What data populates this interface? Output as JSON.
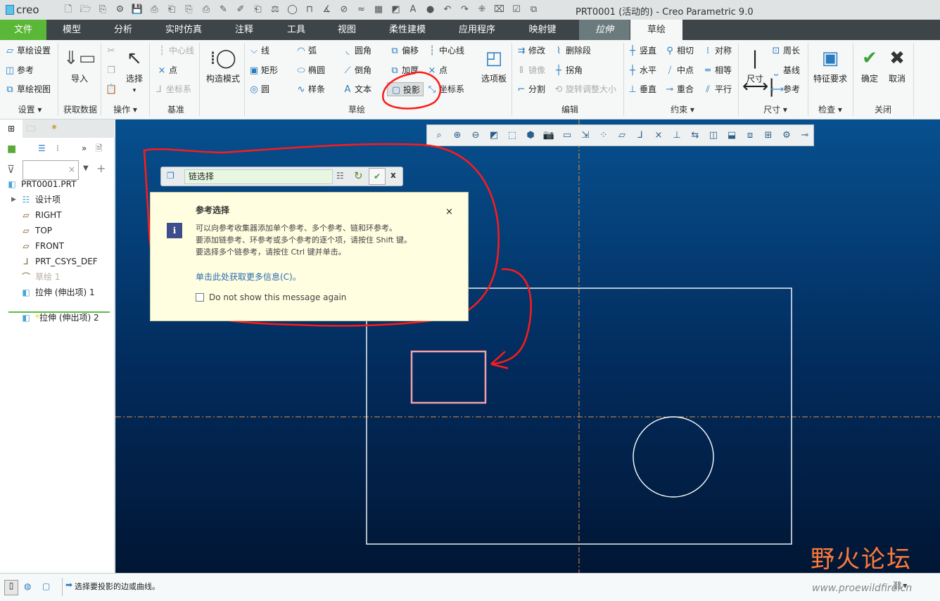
{
  "titlebar": {
    "logo": "creo",
    "title": "PRT0001 (活动的) - Creo Parametric 9.0",
    "quick_access_icons": [
      "new-icon",
      "open-icon",
      "regenerate-icon",
      "switch-window-icon",
      "save-icon",
      "save-as-icon",
      "backup-icon",
      "copy-icon",
      "print-icon",
      "close-icon",
      "cut-icon",
      "paste-icon",
      "measure-icon",
      "shading-icon",
      "dimension-icon",
      "angle-icon",
      "diameter-icon",
      "spline-icon",
      "color-icon",
      "appearance-icon",
      "text-icon",
      "sphere-icon",
      "undo-icon",
      "redo-icon",
      "settings-icon",
      "close-window-icon",
      "select-icon",
      "window-icon"
    ]
  },
  "tabs": [
    {
      "label": "文件"
    },
    {
      "label": "模型"
    },
    {
      "label": "分析"
    },
    {
      "label": "实时仿真"
    },
    {
      "label": "注释"
    },
    {
      "label": "工具"
    },
    {
      "label": "视图"
    },
    {
      "label": "柔性建模"
    },
    {
      "label": "应用程序"
    },
    {
      "label": "映射键"
    },
    {
      "label": "拉伸"
    },
    {
      "label": "草绘"
    }
  ],
  "ribbon": {
    "setup": {
      "items": [
        "草绘设置",
        "参考",
        "草绘视图"
      ],
      "label": "设置"
    },
    "get_data": {
      "import": "导入",
      "label": "获取数据"
    },
    "operations": {
      "select": "选择",
      "label": "操作"
    },
    "datum": {
      "items": [
        "中心线",
        "点",
        "坐标系"
      ],
      "label": "基准"
    },
    "construction": "构造模式",
    "sketch": {
      "col1": [
        "线",
        "矩形",
        "圆"
      ],
      "col2": [
        "弧",
        "椭圆",
        "样条"
      ],
      "col3": [
        "圆角",
        "倒角",
        "文本"
      ],
      "col4": [
        "偏移",
        "加厚",
        "投影"
      ],
      "col5": [
        "中心线",
        "点",
        "坐标系"
      ],
      "label": "草绘"
    },
    "palette": "选项板",
    "edit": {
      "col1": [
        "修改",
        "镜像",
        "分割"
      ],
      "col2": [
        "删除段",
        "拐角",
        "旋转调整大小"
      ],
      "label": "编辑"
    },
    "constrain": {
      "col1": [
        "竖直",
        "水平",
        "垂直"
      ],
      "col2": [
        "相切",
        "中点",
        "重合"
      ],
      "col3": [
        "对称",
        "相等",
        "平行"
      ],
      "label": "约束"
    },
    "dimension": {
      "big": "尺寸",
      "items": [
        "周长",
        "基线",
        "参考"
      ],
      "label": "尺寸"
    },
    "inspect": {
      "big": "特征要求",
      "label": "检查"
    },
    "close": {
      "ok": "确定",
      "cancel": "取消",
      "label": "关闭"
    }
  },
  "sidebar": {
    "filter_placeholder": "",
    "tree": [
      {
        "label": "PRT0001.PRT",
        "icon": "part-icon"
      },
      {
        "label": "设计项",
        "icon": "design-items-icon"
      },
      {
        "label": "RIGHT",
        "icon": "datum-plane-icon"
      },
      {
        "label": "TOP",
        "icon": "datum-plane-icon"
      },
      {
        "label": "FRONT",
        "icon": "datum-plane-icon"
      },
      {
        "label": "PRT_CSYS_DEF",
        "icon": "csys-icon"
      },
      {
        "label": "草绘 1",
        "icon": "sketch-icon"
      },
      {
        "label": "拉伸 (伸出项) 1",
        "icon": "extrude-icon"
      },
      {
        "label": "拉伸 (伸出项) 2",
        "icon": "extrude-icon"
      }
    ]
  },
  "collector": {
    "value": "链选择"
  },
  "popup": {
    "title": "参考选择",
    "lines": [
      "可以向参考收集器添加单个参考、多个参考、链和环参考。",
      "要添加链参考、环参考或多个参考的逐个项，请按住 Shift 键。",
      "要选择多个链参考，请按住 Ctrl 键并单击。"
    ],
    "link": "单击此处获取更多信息(C)。",
    "checkbox": "Do not show this message again",
    "checked": false
  },
  "status": {
    "message": "选择要投影的边或曲线。"
  },
  "watermark": {
    "text": "野火论坛",
    "url": "www.proewildfire.cn"
  },
  "colors": {
    "file_tab": "#5ab738",
    "sketch_lines": "#ffffff",
    "selected_edge": "#f4a0a8",
    "datum_axis": "#e0913a",
    "annotation": "#ff1a1a"
  }
}
